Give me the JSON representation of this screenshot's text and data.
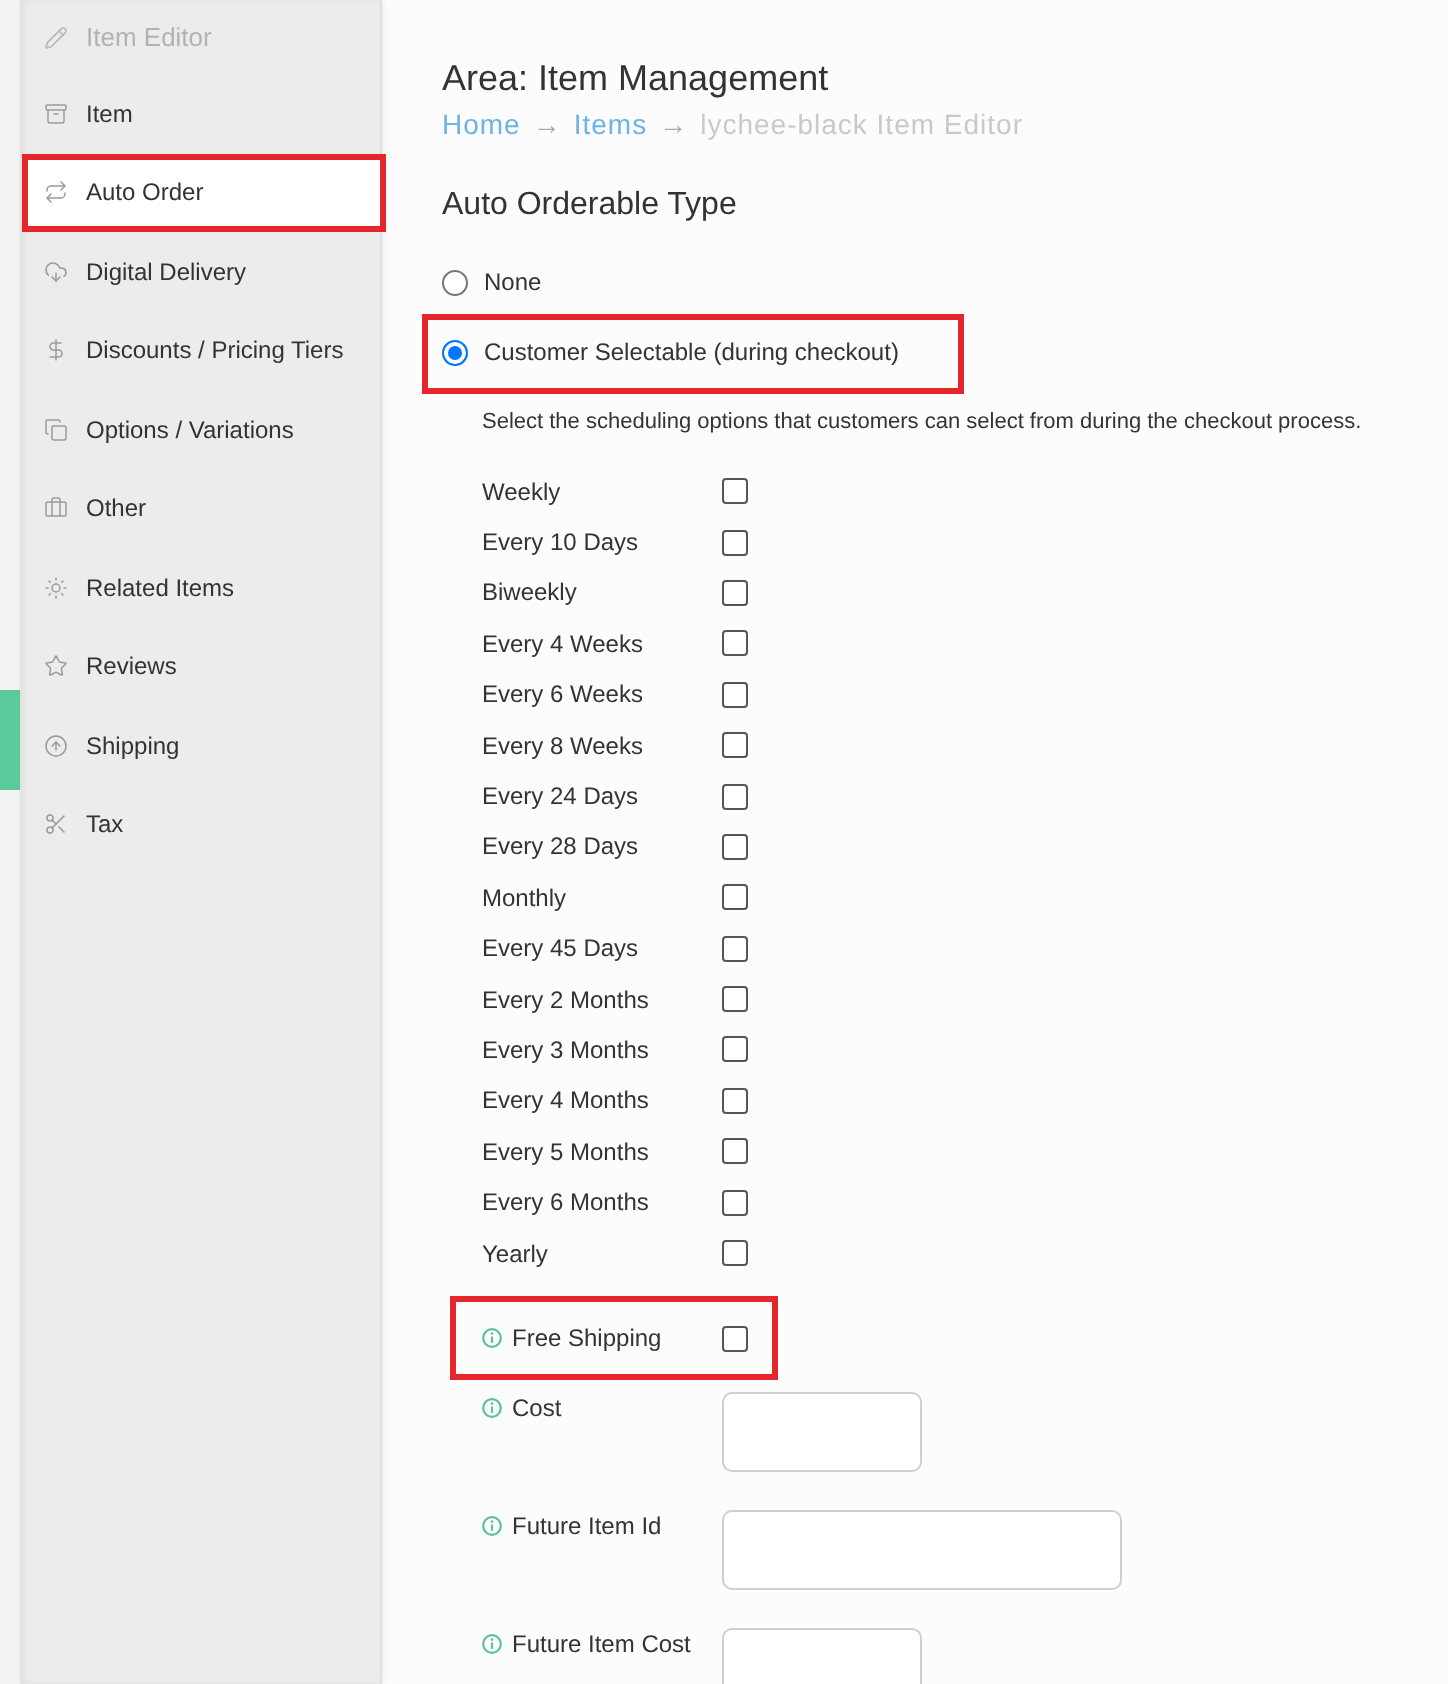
{
  "sidebar": {
    "title": "Item Editor",
    "items": [
      {
        "label": "Item",
        "selected": false,
        "highlighted": false
      },
      {
        "label": "Auto Order",
        "selected": true,
        "highlighted": true
      },
      {
        "label": "Digital Delivery",
        "selected": false,
        "highlighted": false
      },
      {
        "label": "Discounts / Pricing Tiers",
        "selected": false,
        "highlighted": false
      },
      {
        "label": "Options / Variations",
        "selected": false,
        "highlighted": false
      },
      {
        "label": "Other",
        "selected": false,
        "highlighted": false
      },
      {
        "label": "Related Items",
        "selected": false,
        "highlighted": false
      },
      {
        "label": "Reviews",
        "selected": false,
        "highlighted": false
      },
      {
        "label": "Shipping",
        "selected": false,
        "highlighted": false
      },
      {
        "label": "Tax",
        "selected": false,
        "highlighted": false
      }
    ]
  },
  "page": {
    "title": "Area: Item Management",
    "breadcrumb": [
      {
        "kind": "link",
        "text": "Home"
      },
      {
        "kind": "separator",
        "text": "→"
      },
      {
        "kind": "link",
        "text": "Items"
      },
      {
        "kind": "separator",
        "text": "→"
      },
      {
        "kind": "current",
        "text": "lychee-black Item Editor"
      }
    ]
  },
  "auto_orderable_type": {
    "heading": "Auto Orderable Type",
    "options": [
      {
        "label": "None",
        "selected": false,
        "highlighted": false
      },
      {
        "label": "Customer Selectable (during checkout)",
        "selected": true,
        "highlighted": true
      }
    ],
    "description": "Select the scheduling options that customers can select from during the checkout process.",
    "schedules": [
      {
        "label": "Weekly",
        "checked": false
      },
      {
        "label": "Every 10 Days",
        "checked": false
      },
      {
        "label": "Biweekly",
        "checked": false
      },
      {
        "label": "Every 4 Weeks",
        "checked": false
      },
      {
        "label": "Every 6 Weeks",
        "checked": false
      },
      {
        "label": "Every 8 Weeks",
        "checked": false
      },
      {
        "label": "Every 24 Days",
        "checked": false
      },
      {
        "label": "Every 28 Days",
        "checked": false
      },
      {
        "label": "Monthly",
        "checked": false
      },
      {
        "label": "Every 45 Days",
        "checked": false
      },
      {
        "label": "Every 2 Months",
        "checked": false
      },
      {
        "label": "Every 3 Months",
        "checked": false
      },
      {
        "label": "Every 4 Months",
        "checked": false
      },
      {
        "label": "Every 5 Months",
        "checked": false
      },
      {
        "label": "Every 6 Months",
        "checked": false
      },
      {
        "label": "Yearly",
        "checked": false
      }
    ]
  },
  "fields": [
    {
      "kind": "checkbox",
      "label": "Free Shipping",
      "checked": false,
      "highlighted": true
    },
    {
      "kind": "number",
      "label": "Cost",
      "highlighted": false
    },
    {
      "kind": "text",
      "label": "Future Item Id",
      "highlighted": false
    },
    {
      "kind": "number",
      "label": "Future Item Cost",
      "highlighted": false
    }
  ]
}
